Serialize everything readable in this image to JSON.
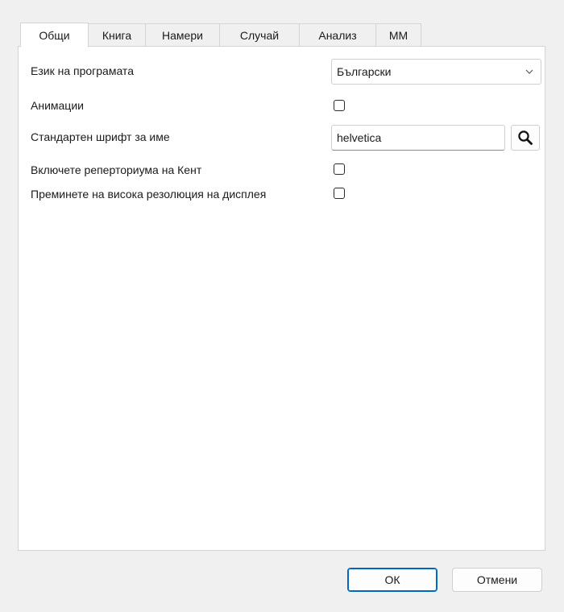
{
  "tabs": [
    {
      "label": "Общи",
      "active": true
    },
    {
      "label": "Книга",
      "active": false
    },
    {
      "label": "Намери",
      "active": false
    },
    {
      "label": "Случай",
      "active": false
    },
    {
      "label": "Анализ",
      "active": false
    },
    {
      "label": "ММ",
      "active": false
    }
  ],
  "general": {
    "language_label": "Език на програмата",
    "language_value": "Български",
    "animations_label": "Анимации",
    "animations_checked": false,
    "font_label": "Стандартен шрифт за име",
    "font_value": "helvetica",
    "kent_label": "Включете реперториума на Кент",
    "kent_checked": false,
    "hidpi_label": "Преминете на висока резолюция на дисплея",
    "hidpi_checked": false
  },
  "icons": {
    "dropdown": "chevron-down-icon",
    "search": "search-icon"
  },
  "buttons": {
    "ok_label": "ОК",
    "cancel_label": "Отмени"
  },
  "colors": {
    "accent": "#0067c0",
    "window_bg": "#f0f0f0",
    "panel_bg": "#ffffff"
  }
}
